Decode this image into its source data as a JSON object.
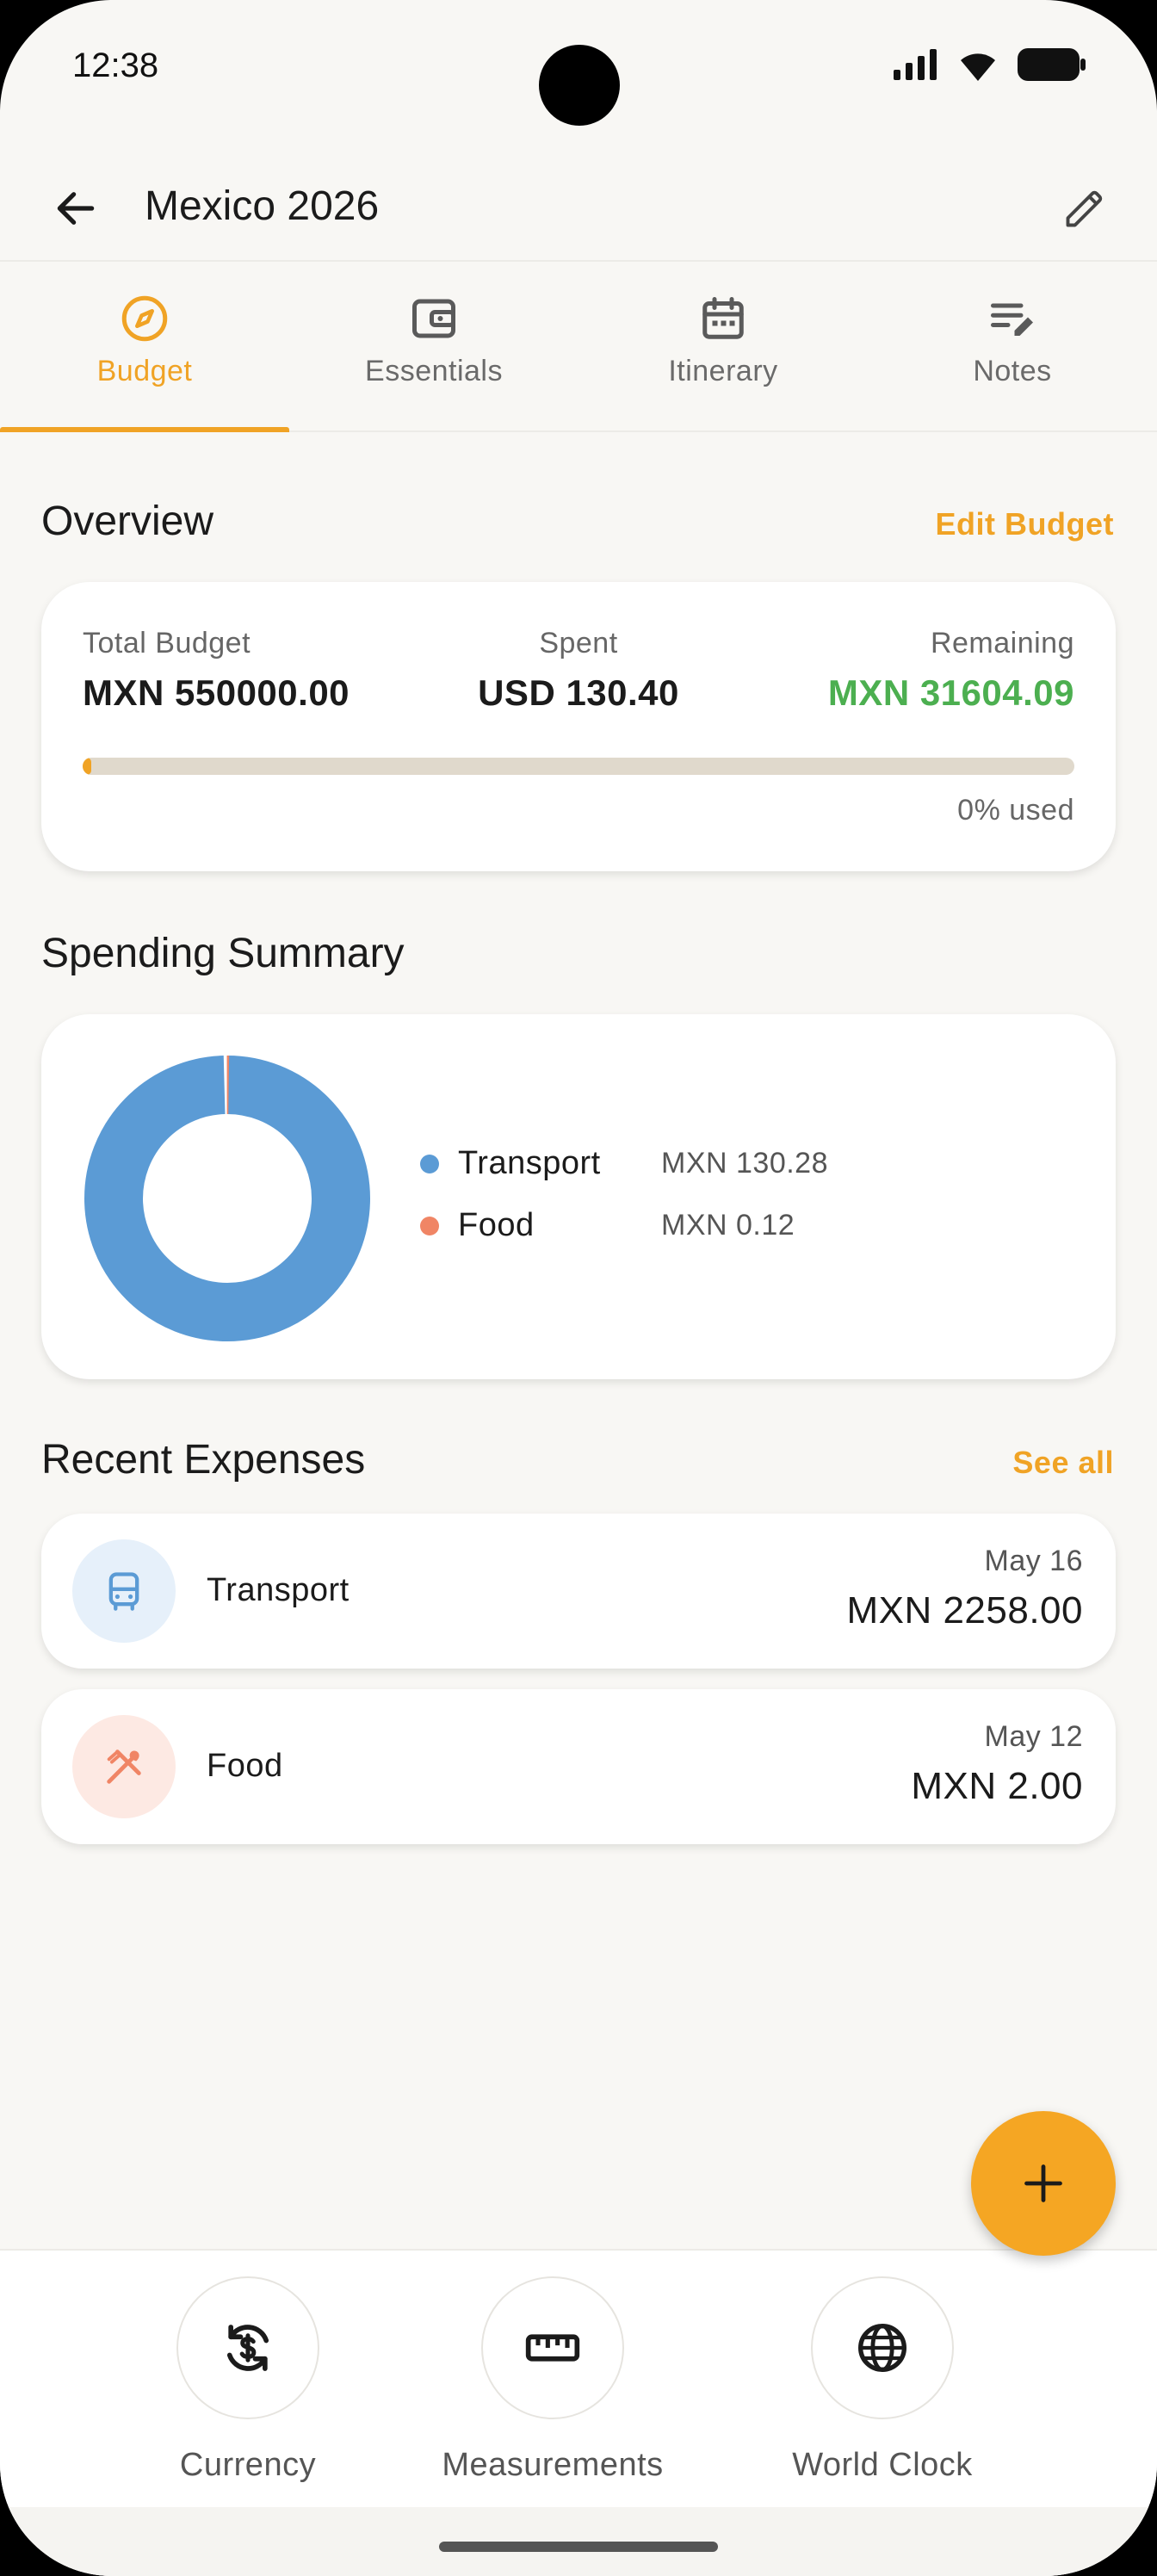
{
  "status_bar": {
    "time": "12:38"
  },
  "app_bar": {
    "title": "Mexico 2026"
  },
  "tabs": [
    {
      "label": "Budget",
      "icon": "compass-icon",
      "active": true
    },
    {
      "label": "Essentials",
      "icon": "wallet-icon",
      "active": false
    },
    {
      "label": "Itinerary",
      "icon": "calendar-icon",
      "active": false
    },
    {
      "label": "Notes",
      "icon": "notes-icon",
      "active": false
    }
  ],
  "overview": {
    "title": "Overview",
    "edit_label": "Edit Budget",
    "total_label": "Total Budget",
    "total_value": "MXN 550000.00",
    "spent_label": "Spent",
    "spent_value": "USD 130.40",
    "remaining_label": "Remaining",
    "remaining_value": "MXN 31604.09",
    "progress_fraction": 0.0,
    "progress_text": "0% used"
  },
  "spending_summary": {
    "title": "Spending Summary",
    "items": [
      {
        "name": "Transport",
        "value": "MXN 130.28",
        "color": "#5b9bd5"
      },
      {
        "name": "Food",
        "value": "MXN 0.12",
        "color": "#f08565"
      }
    ]
  },
  "chart_data": {
    "type": "pie",
    "donut": true,
    "categories": [
      "Transport",
      "Food"
    ],
    "values": [
      130.28,
      0.12
    ],
    "colors": [
      "#5b9bd5",
      "#f08565"
    ]
  },
  "recent_expenses": {
    "title": "Recent Expenses",
    "see_all_label": "See all",
    "items": [
      {
        "category": "Transport",
        "date": "May 16",
        "amount": "MXN 2258.00",
        "icon": "bus-icon",
        "icon_color": "#5b9bd5",
        "icon_bg": "#e6f0fa"
      },
      {
        "category": "Food",
        "date": "May 12",
        "amount": "MXN 2.00",
        "icon": "utensils-icon",
        "icon_color": "#f08565",
        "icon_bg": "#fde9e3"
      }
    ]
  },
  "tools": [
    {
      "label": "Currency",
      "icon": "currency-exchange-icon"
    },
    {
      "label": "Measurements",
      "icon": "ruler-icon"
    },
    {
      "label": "World Clock",
      "icon": "globe-icon"
    }
  ],
  "colors": {
    "accent": "#f0a325",
    "positive": "#4caf50",
    "background": "#f8f7f4"
  }
}
